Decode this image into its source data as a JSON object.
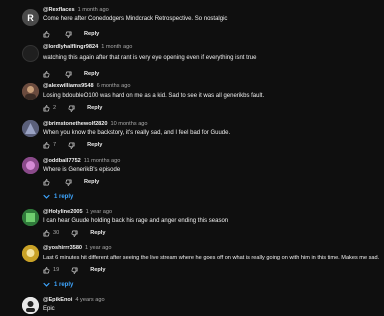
{
  "colors": {
    "background": "#0f0f0f",
    "text": "#f1f1f1",
    "secondary": "#aaaaaa",
    "link": "#3ea6ff"
  },
  "comments": [
    {
      "author": "@Rexflaces",
      "time": "1 month ago",
      "text": "Come here after Conedodgers Mindcrack Retrospective. So nostalgic",
      "likes": "",
      "reply": "Reply",
      "avatar_color": "#4a4a4a",
      "avatar_letter": "R"
    },
    {
      "author": "@lordlyhalflingr9824",
      "time": "1 month ago",
      "text": "watching this again after that rant is very eye opening even if everything isnt true",
      "likes": "",
      "reply": "Reply",
      "avatar_color": "#1f1f1f",
      "avatar_letter": ""
    },
    {
      "author": "@alexwilliams9548",
      "time": "6 months ago",
      "text": "Losing bdoubleO100 was hard on me as a kid. Sad to see it was all generikbs fault.",
      "likes": "2",
      "reply": "Reply",
      "avatar_color": "#6b4b3e",
      "avatar_letter": ""
    },
    {
      "author": "@brimstonethewolf2820",
      "time": "10 months ago",
      "text": "When you know the backstory, it's really sad, and I feel bad for Guude.",
      "likes": "7",
      "reply": "Reply",
      "avatar_color": "#5a5f7a",
      "avatar_letter": ""
    },
    {
      "author": "@oddball7752",
      "time": "11 months ago",
      "text": "Where is GenerikB's episode",
      "likes": "",
      "reply": "Reply",
      "replies_label": "1 reply",
      "avatar_color": "#8a4a8a",
      "avatar_letter": ""
    },
    {
      "author": "@Holyline2005",
      "time": "1 year ago",
      "text": "I can hear Guude holding back his rage and anger ending this season",
      "likes": "30",
      "reply": "Reply",
      "avatar_color": "#2f7a3a",
      "avatar_letter": ""
    },
    {
      "author": "@yoshirrr3580",
      "time": "1 year ago",
      "text": "Last 6 minutes hit different after seeing the live stream where he goes off on what is really going on with him in this time. Makes me sad.",
      "likes": "19",
      "reply": "Reply",
      "replies_label": "1 reply",
      "avatar_color": "#c9a227",
      "avatar_letter": ""
    },
    {
      "author": "@EpikEnoi",
      "time": "4 years ago",
      "text": "Epic",
      "likes": "",
      "reply": "",
      "avatar_color": "#e8e8e8",
      "avatar_letter": ""
    }
  ]
}
